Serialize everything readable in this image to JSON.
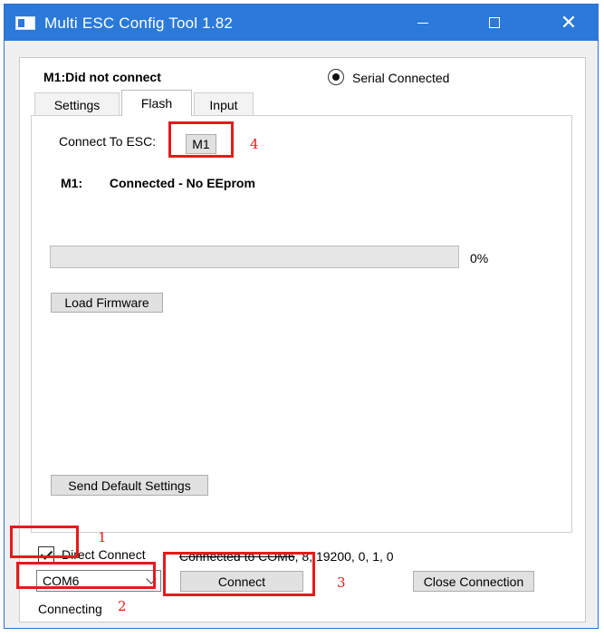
{
  "window": {
    "title": "Multi ESC Config Tool 1.82",
    "controls": {
      "minimize": "minimize",
      "maximize": "maximize",
      "close": "✕"
    }
  },
  "header": {
    "device_status": "M1:Did not connect",
    "radio_label": "Serial Connected",
    "radio_selected": true
  },
  "tabs": [
    {
      "label": "Settings",
      "active": false
    },
    {
      "label": "Flash",
      "active": true
    },
    {
      "label": "Input",
      "active": false
    }
  ],
  "flash": {
    "connect_label": "Connect To ESC:",
    "esc_button": "M1",
    "status_name": "M1:",
    "status_value": "Connected - No EEprom",
    "progress_label": "0%",
    "progress_value": 0,
    "load_firmware": "Load Firmware",
    "send_defaults": "Send Default Settings"
  },
  "bottom": {
    "direct_connect_label": "Direct Connect",
    "direct_connect_checked": true,
    "connection_info_struck": "Connected to COM6",
    "connection_info_rest": ", 8, 19200, 0, 1, 0",
    "port_value": "COM6",
    "connect_button": "Connect",
    "close_button": "Close Connection",
    "status": "Connecting"
  },
  "annotations": [
    "1",
    "2",
    "3",
    "4"
  ],
  "colors": {
    "titlebar": "#2b79d9",
    "annotation": "#e8191a"
  },
  "icons": {
    "app": "app-window-icon",
    "dropdown": "chevron-down-icon"
  }
}
